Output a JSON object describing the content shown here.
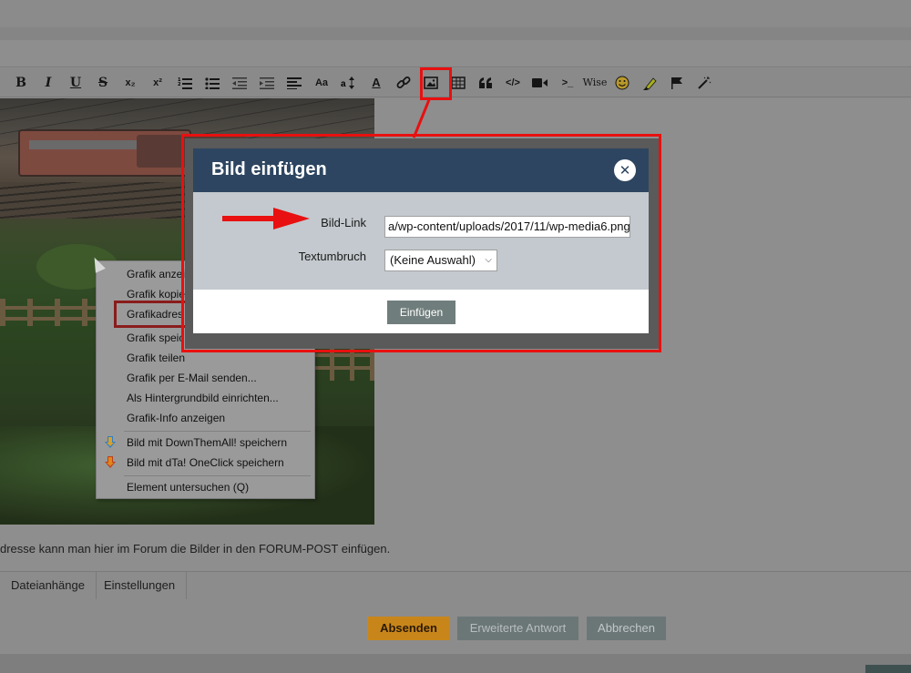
{
  "toolbar": {
    "bold": "B",
    "italic": "I",
    "underline": "U",
    "strike": "S",
    "subscript": "x₂",
    "superscript": "x²",
    "font_size": "Aa",
    "text_color": "A",
    "wise": "Wise",
    "terminal": ">_"
  },
  "context_menu": {
    "items": [
      "Grafik anzeigen",
      "Grafik kopieren",
      "Grafikadresse kopieren",
      "Grafik speichern unter...",
      "Grafik teilen",
      "Grafik per E-Mail senden...",
      "Als Hintergrundbild einrichten...",
      "Grafik-Info anzeigen",
      "Bild mit DownThemAll! speichern",
      "Bild mit dTa! OneClick speichern",
      "Element untersuchen (Q)"
    ],
    "visible_items": [
      "Grafik anzei",
      "Grafik kopie",
      "Grafikadres",
      "Grafik speic  ern unter...",
      "Grafik teilen",
      "Grafik per E-Mail senden...",
      "Als Hintergrundbild einrichten...",
      "Grafik-Info anzeigen",
      "Bild mit DownThemAll! speichern",
      "Bild mit dTa! OneClick speichern",
      "Element untersuchen (Q)"
    ]
  },
  "dialog": {
    "title": "Bild einfügen",
    "close_symbol": "✕",
    "image_link_label": "Bild-Link",
    "image_link_value": "a/wp-content/uploads/2017/11/wp-media6.png",
    "text_wrap_label": "Textumbruch",
    "text_wrap_value": "(Keine Auswahl)",
    "insert_button": "Einfügen"
  },
  "editor": {
    "hint_text": "dresse kann man hier im Forum die Bilder in den FORUM-POST einfügen."
  },
  "tabs": [
    "Dateianhänge",
    "Einstellungen"
  ],
  "actions": {
    "submit": "Absenden",
    "extended_reply": "Erweiterte Antwort",
    "cancel": "Abbrechen"
  },
  "colors": {
    "dialog_header": "#2d4560",
    "highlight_red": "#e81010",
    "submit_orange": "#c8861a",
    "button_gray": "#6b7677"
  }
}
